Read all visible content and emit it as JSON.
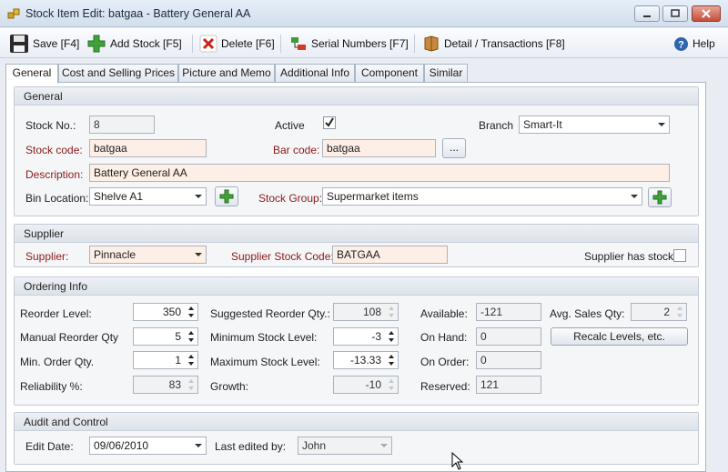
{
  "window": {
    "title": "Stock Item Edit: batgaa - Battery General AA"
  },
  "toolbar": {
    "save": "Save [F4]",
    "add_stock": "Add Stock [F5]",
    "delete": "Delete [F6]",
    "serial_numbers": "Serial Numbers [F7]",
    "detail_transactions": "Detail / Transactions [F8]",
    "help": "Help"
  },
  "tabs": [
    "General",
    "Cost and Selling Prices",
    "Picture and Memo",
    "Additional Info",
    "Component",
    "Similar"
  ],
  "general": {
    "heading": "General",
    "stock_no_label": "Stock No.:",
    "stock_no": "8",
    "active_label": "Active",
    "active_checked": true,
    "branch_label": "Branch",
    "branch": "Smart-It",
    "stock_code_label": "Stock code:",
    "stock_code": "batgaa",
    "bar_code_label": "Bar code:",
    "bar_code": "batgaa",
    "browse_label": "...",
    "description_label": "Description:",
    "description": "Battery General AA",
    "bin_location_label": "Bin Location:",
    "bin_location": "Shelve A1",
    "stock_group_label": "Stock Group:",
    "stock_group": "Supermarket items"
  },
  "supplier": {
    "heading": "Supplier",
    "supplier_label": "Supplier:",
    "supplier": "Pinnacle",
    "supplier_stock_code_label": "Supplier Stock Code:",
    "supplier_stock_code": "BATGAA",
    "supplier_has_stock_label": "Supplier has stock:",
    "supplier_has_stock": false
  },
  "ordering": {
    "heading": "Ordering Info",
    "reorder_level_label": "Reorder Level:",
    "reorder_level": "350",
    "manual_reorder_label": "Manual Reorder Qty",
    "manual_reorder": "5",
    "min_order_label": "Min. Order Qty.",
    "min_order": "1",
    "reliability_label": "Reliability %:",
    "reliability": "83",
    "suggested_reorder_label": "Suggested Reorder Qty.:",
    "suggested_reorder": "108",
    "minimum_stock_label": "Minimum Stock  Level:",
    "minimum_stock": "-3",
    "maximum_stock_label": "Maximum Stock Level:",
    "maximum_stock": "-13.33",
    "growth_label": "Growth:",
    "growth": "-10",
    "available_label": "Available:",
    "available": "-121",
    "on_hand_label": "On Hand:",
    "on_hand": "0",
    "on_order_label": "On Order:",
    "on_order": "0",
    "reserved_label": "Reserved:",
    "reserved": "121",
    "avg_sales_label": "Avg. Sales Qty:",
    "avg_sales": "2",
    "recalc_label": "Recalc Levels, etc."
  },
  "audit": {
    "heading": "Audit and Control",
    "edit_date_label": "Edit Date:",
    "edit_date": "09/06/2010",
    "last_edited_label": "Last edited by:",
    "last_edited": "John"
  },
  "colors": {
    "required_label": "#8b1a1a",
    "required_field_bg": "#fdeee6",
    "accent": "#2f64b0"
  }
}
